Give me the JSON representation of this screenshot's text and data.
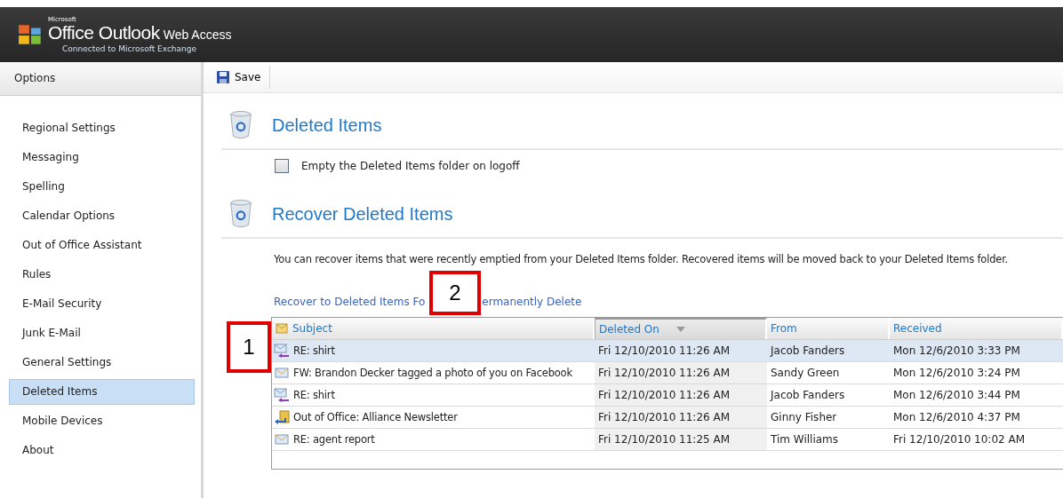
{
  "header": {
    "brand_small": "Microsoft",
    "product": "Office Outlook",
    "product_suffix": "Web Access",
    "subtitle": "Connected to Microsoft Exchange"
  },
  "sidebar": {
    "title": "Options",
    "items": [
      {
        "label": "Regional Settings",
        "selected": false
      },
      {
        "label": "Messaging",
        "selected": false
      },
      {
        "label": "Spelling",
        "selected": false
      },
      {
        "label": "Calendar Options",
        "selected": false
      },
      {
        "label": "Out of Office Assistant",
        "selected": false
      },
      {
        "label": "Rules",
        "selected": false
      },
      {
        "label": "E-Mail Security",
        "selected": false
      },
      {
        "label": "Junk E-Mail",
        "selected": false
      },
      {
        "label": "General Settings",
        "selected": false
      },
      {
        "label": "Deleted Items",
        "selected": true
      },
      {
        "label": "Mobile Devices",
        "selected": false
      },
      {
        "label": "About",
        "selected": false
      }
    ]
  },
  "toolbar": {
    "save": "Save"
  },
  "deleted_section": {
    "title": "Deleted Items",
    "checkbox": {
      "label": "Empty the Deleted Items folder on logoff",
      "checked": false
    }
  },
  "recover_section": {
    "title": "Recover Deleted Items",
    "description": "You can recover items that were recently emptied from your Deleted Items folder. Recovered items will be moved back to your Deleted Items folder.",
    "links": [
      "Recover to Deleted Items Fo",
      "ermanently Delete"
    ]
  },
  "table": {
    "columns": [
      {
        "label": "Subject",
        "sorted": false
      },
      {
        "label": "Deleted On",
        "sorted": true
      },
      {
        "label": "From",
        "sorted": false
      },
      {
        "label": "Received",
        "sorted": false
      }
    ],
    "rows": [
      {
        "kind": "reply",
        "subject": "RE: shirt",
        "deleted_on": "Fri 12/10/2010 11:26 AM",
        "from": "Jacob Fanders",
        "received": "Mon 12/6/2010 3:33 PM",
        "selected": true
      },
      {
        "kind": "message",
        "subject": "FW: Brandon Decker tagged a photo of you on Facebook",
        "deleted_on": "Fri 12/10/2010 11:26 AM",
        "from": "Sandy Green",
        "received": "Mon 12/6/2010 3:24 PM",
        "selected": false
      },
      {
        "kind": "reply",
        "subject": "RE: shirt",
        "deleted_on": "Fri 12/10/2010 11:26 AM",
        "from": "Jacob Fanders",
        "received": "Mon 12/6/2010 3:44 PM",
        "selected": false
      },
      {
        "kind": "out_of_office",
        "subject": "Out of Office: Alliance Newsletter",
        "deleted_on": "Fri 12/10/2010 11:26 AM",
        "from": "Ginny Fisher",
        "received": "Mon 12/6/2010 4:37 PM",
        "selected": false
      },
      {
        "kind": "message",
        "subject": "RE: agent report",
        "deleted_on": "Fri 12/10/2010 11:25 AM",
        "from": "Tim Williams",
        "received": "Fri 12/10/2010 10:02 AM",
        "selected": false
      }
    ]
  },
  "callouts": [
    "1",
    "2"
  ]
}
